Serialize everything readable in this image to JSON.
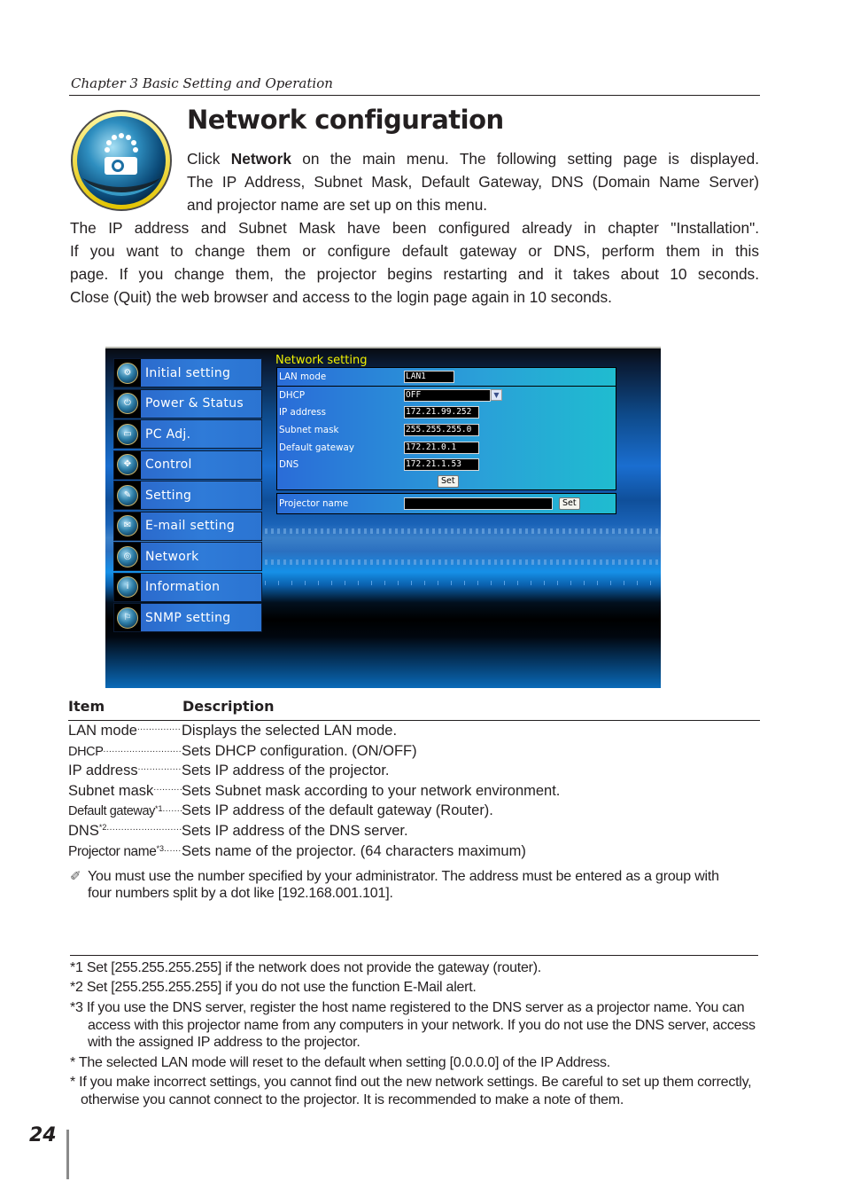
{
  "header": {
    "chapter": "Chapter 3 Basic Setting and Operation",
    "chapter_icon": "network-projector-icon"
  },
  "title": "Network configuration",
  "intro": {
    "line1_pre": "Click ",
    "line1_bold": "Network",
    "line1_post": " on the main menu. The following setting page is displayed.",
    "line2": "The IP Address, Subnet Mask, Default Gateway, DNS (Domain Name Server)",
    "line3": "and projector name are set up on this menu.",
    "para2": [
      "The IP address and Subnet Mask have been configured already in chapter \"Installation\".",
      "If you want to change them or configure default gateway or DNS, perform them in this",
      "page. If you change them, the projector begins restarting and it takes about 10 seconds.",
      "Close (Quit) the web browser and access to the login page again in 10 seconds."
    ]
  },
  "screenshot": {
    "menu": [
      {
        "label": "Initial setting",
        "icon": "gear-icon",
        "glyph": "⚙"
      },
      {
        "label": "Power & Status",
        "icon": "power-icon",
        "glyph": "⏻"
      },
      {
        "label": "PC Adj.",
        "icon": "monitor-icon",
        "glyph": "▭"
      },
      {
        "label": "Control",
        "icon": "control-pad-icon",
        "glyph": "✥"
      },
      {
        "label": "Setting",
        "icon": "wrench-icon",
        "glyph": "✎"
      },
      {
        "label": "E-mail setting",
        "icon": "envelope-icon",
        "glyph": "✉"
      },
      {
        "label": "Network",
        "icon": "network-icon",
        "glyph": "◎"
      },
      {
        "label": "Information",
        "icon": "info-icon",
        "glyph": "i"
      },
      {
        "label": "SNMP setting",
        "icon": "snmp-icon",
        "glyph": "⚐"
      }
    ],
    "panel_title": "Network setting",
    "fields": {
      "lan_mode": {
        "label": "LAN mode",
        "value": "LAN1"
      },
      "dhcp": {
        "label": "DHCP",
        "value": "OFF"
      },
      "ip_address": {
        "label": "IP address",
        "value": "172.21.99.252"
      },
      "subnet_mask": {
        "label": "Subnet mask",
        "value": "255.255.255.0"
      },
      "default_gateway": {
        "label": "Default gateway",
        "value": "172.21.0.1"
      },
      "dns": {
        "label": "DNS",
        "value": "172.21.1.53"
      },
      "projector_name": {
        "label": "Projector name",
        "value": ""
      }
    },
    "set_label": "Set",
    "dropdown_arrow": "▼"
  },
  "table": {
    "head_item": "Item",
    "head_desc": "Description",
    "rows": [
      {
        "item": "LAN mode",
        "sup": "",
        "desc": "Displays the selected LAN mode."
      },
      {
        "item": "DHCP",
        "sup": "",
        "desc": "Sets DHCP configuration. (ON/OFF)"
      },
      {
        "item": "IP address",
        "sup": "",
        "desc": "Sets IP address of the projector."
      },
      {
        "item": "Subnet mask",
        "sup": "",
        "desc": "Sets Subnet mask according to your network environment."
      },
      {
        "item": "Default gateway",
        "sup": "*1",
        "desc": "Sets IP address of the default gateway (Router)."
      },
      {
        "item": "DNS",
        "sup": "*2",
        "desc": "Sets IP address of the DNS server."
      },
      {
        "item": "Projector name",
        "sup": "*3",
        "desc": "Sets name of the projector. (64 characters maximum)"
      }
    ]
  },
  "note": {
    "icon": "✐",
    "text": "You must use the number specified by your administrator. The address must be entered as a group with four numbers split by a dot like [192.168.001.101]."
  },
  "footnotes": [
    "*1 Set [255.255.255.255] if the network does not provide the gateway (router).",
    "*2 Set [255.255.255.255] if you do not use the function E-Mail alert.",
    "*3 If you use the DNS server, register the host name registered to the DNS server as a projector name. You can access with this projector name from any computers in your network. If you do not use the DNS server, access with the assigned IP address to the projector.",
    "* The selected LAN mode will reset to the default when setting [0.0.0.0] of the IP Address.",
    "* If you make incorrect settings, you cannot find out the new network settings. Be careful to set up them correctly, otherwise you cannot connect to the projector. It is recommended to make a note of them."
  ],
  "page_number": "24"
}
